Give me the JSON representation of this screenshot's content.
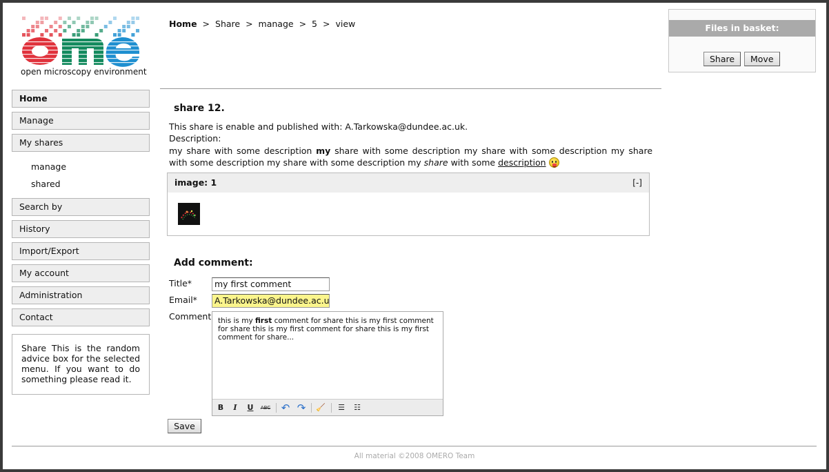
{
  "logo": {
    "tagline": "open microscopy environment",
    "colors": {
      "o": "#e0323c",
      "m": "#138a5e",
      "e": "#1e8fd0"
    }
  },
  "breadcrumb": {
    "home": "Home",
    "items": [
      "Share",
      "manage",
      "5",
      "view"
    ],
    "separator": ">"
  },
  "basket": {
    "title": "Files in basket:",
    "share_label": "Share",
    "move_label": "Move"
  },
  "nav": {
    "items": [
      "Home",
      "Manage",
      "My shares",
      "Search by",
      "History",
      "Import/Export",
      "My account",
      "Administration",
      "Contact"
    ],
    "sub_items": [
      "manage",
      "shared"
    ],
    "advice": "Share This is the random advice box for the selected menu. If you want to do something please read it."
  },
  "share": {
    "title": "share 12.",
    "published_text": "This share is enable and published with: A.Tarkowska@dundee.ac.uk.",
    "description_label": "Description:",
    "description": {
      "p1": "my share with some description ",
      "bold": "my",
      "p2": " share with some description my share with some description my share with some description my share with some description my ",
      "italic": "share",
      "p3": " with some ",
      "underline": "description",
      "emoji": "smiley-tongue-icon"
    }
  },
  "images_panel": {
    "title": "image: 1",
    "toggle": "[-]"
  },
  "comment_form": {
    "title": "Add comment:",
    "title_label": "Title*",
    "title_value": "my first comment",
    "email_label": "Email*",
    "email_value": "A.Tarkowska@dundee.ac.u",
    "comment_label": "Comment",
    "comment": {
      "p1": "this is my ",
      "bold": "first",
      "p2": " comment for share this is my first comment for share this is my first comment for share this is my first comment for share..."
    },
    "toolbar": {
      "bold": "B",
      "italic": "I",
      "underline": "U",
      "strike": "ABC",
      "undo": "↶",
      "redo": "↷",
      "clean": "🧹",
      "bullets": "☰",
      "numbers": "☷"
    },
    "save_label": "Save"
  },
  "footer": "All material ©2008 OMERO Team"
}
